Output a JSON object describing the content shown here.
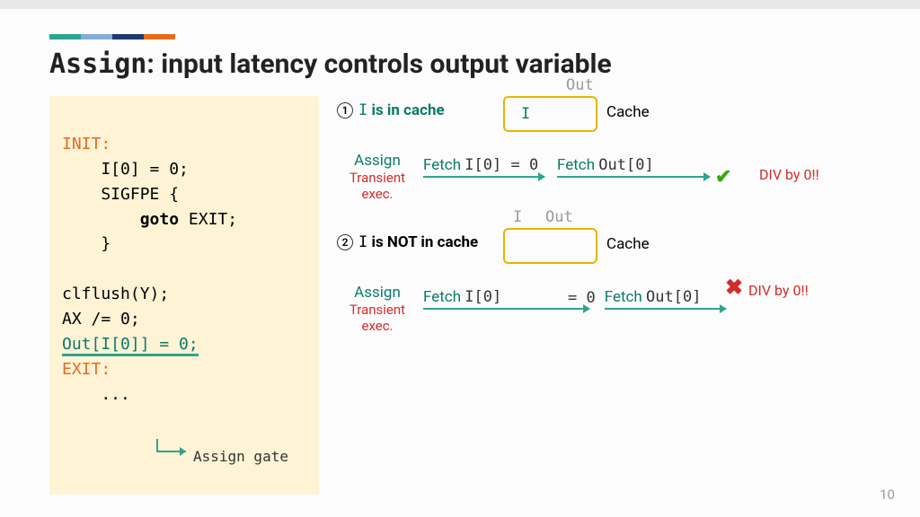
{
  "title_mono": "Assign",
  "title_rest": ": input latency controls output variable",
  "code": {
    "l1": "INIT:",
    "l2": "    I[0] = 0;",
    "l3": "    SIGFPE {",
    "l4_pre": "        ",
    "l4_kw": "goto",
    "l4_post": " EXIT;",
    "l5": "    }",
    "l6": "clflush(Y);",
    "l7": "AX /= 0;",
    "l8": "Out[I[0]] = 0;",
    "l9": "EXIT:",
    "l10": "    ...",
    "gate_mono": "Assign",
    "gate_rest": " gate"
  },
  "labels": {
    "out": "Out",
    "I": "I",
    "cache": "Cache",
    "assign": "Assign",
    "transient": "Transient\nexec.",
    "div0": "DIV by 0!!",
    "one": "1",
    "two": "2"
  },
  "case1": {
    "head_pre": " ",
    "head_mono": "I",
    "head_post": " is in cache",
    "fetch1_pre": "Fetch ",
    "fetch1_mono": "I[0]",
    "eq0": " = ",
    "zero": "0",
    "fetch2_pre": "Fetch ",
    "fetch2_mono": "Out[0]"
  },
  "case2": {
    "head_pre": " ",
    "head_mono": "I",
    "head_post": " is NOT in cache",
    "fetch1_pre": "Fetch ",
    "fetch1_mono": "I[0]",
    "eq0": "= ",
    "zero": "0",
    "fetch2_pre": "Fetch ",
    "fetch2_mono": "Out[0]"
  },
  "pagenum": "10"
}
